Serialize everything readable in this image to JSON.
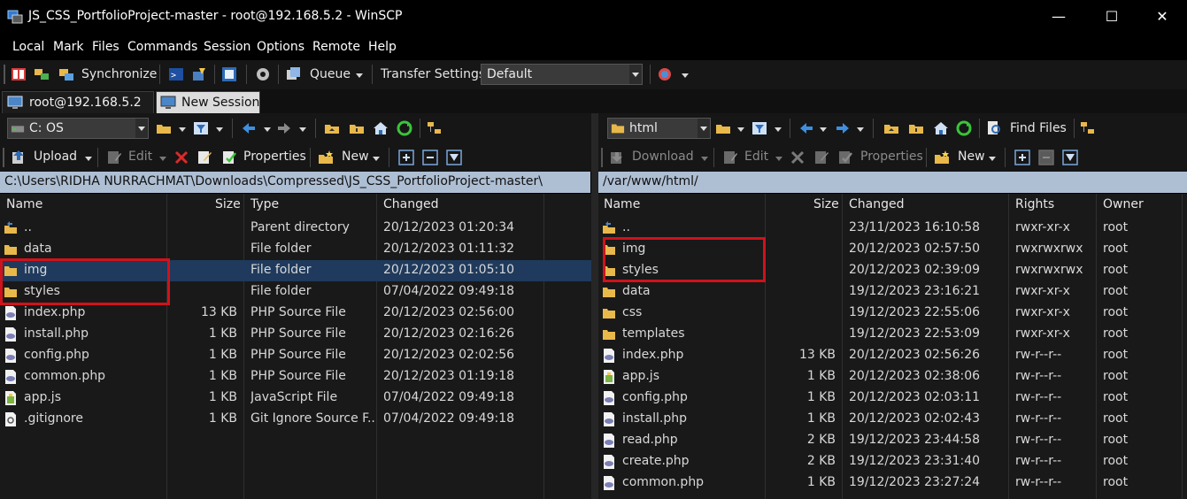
{
  "window": {
    "title": "JS_CSS_PortfolioProject-master - root@192.168.5.2 - WinSCP",
    "minimize": "—",
    "maximize": "☐",
    "close": "✕"
  },
  "menu": [
    "Local",
    "Mark",
    "Files",
    "Commands",
    "Session",
    "Options",
    "Remote",
    "Help"
  ],
  "toolbar": {
    "synchronize": "Synchronize",
    "queue": "Queue",
    "transfer_settings": "Transfer Settings",
    "transfer_preset": "Default"
  },
  "tabs": {
    "session": "root@192.168.5.2",
    "new_session": "New Session"
  },
  "local": {
    "drive": "C: OS",
    "upload": "Upload",
    "edit": "Edit",
    "properties": "Properties",
    "new": "New",
    "path": "C:\\Users\\RIDHA NURRACHMAT\\Downloads\\Compressed\\JS_CSS_PortfolioProject-master\\",
    "columns": [
      "Name",
      "Size",
      "Type",
      "Changed"
    ],
    "rows": [
      {
        "icon": "parent-dir",
        "name": "..",
        "size": "",
        "type": "Parent directory",
        "changed": "20/12/2023  01:20:34"
      },
      {
        "icon": "folder",
        "name": "data",
        "size": "",
        "type": "File folder",
        "changed": "20/12/2023  01:11:32"
      },
      {
        "icon": "folder",
        "name": "img",
        "size": "",
        "type": "File folder",
        "changed": "20/12/2023  01:05:10"
      },
      {
        "icon": "folder",
        "name": "styles",
        "size": "",
        "type": "File folder",
        "changed": "07/04/2022  09:49:18"
      },
      {
        "icon": "php",
        "name": "index.php",
        "size": "13 KB",
        "type": "PHP Source File",
        "changed": "20/12/2023  02:56:00"
      },
      {
        "icon": "php",
        "name": "install.php",
        "size": "1 KB",
        "type": "PHP Source File",
        "changed": "20/12/2023  02:16:26"
      },
      {
        "icon": "php",
        "name": "config.php",
        "size": "1 KB",
        "type": "PHP Source File",
        "changed": "20/12/2023  02:02:56"
      },
      {
        "icon": "php",
        "name": "common.php",
        "size": "1 KB",
        "type": "PHP Source File",
        "changed": "20/12/2023  01:19:18"
      },
      {
        "icon": "js",
        "name": "app.js",
        "size": "1 KB",
        "type": "JavaScript File",
        "changed": "07/04/2022  09:49:18"
      },
      {
        "icon": "gitignore",
        "name": ".gitignore",
        "size": "1 KB",
        "type": "Git Ignore Source F...",
        "changed": "07/04/2022  09:49:18"
      }
    ]
  },
  "remote": {
    "dir": "html",
    "download": "Download",
    "edit": "Edit",
    "properties": "Properties",
    "new": "New",
    "find_files": "Find Files",
    "path": "/var/www/html/",
    "columns": [
      "Name",
      "Size",
      "Changed",
      "Rights",
      "Owner"
    ],
    "rows": [
      {
        "icon": "parent-dir",
        "name": "..",
        "size": "",
        "changed": "23/11/2023 16:10:58",
        "rights": "rwxr-xr-x",
        "owner": "root"
      },
      {
        "icon": "folder",
        "name": "img",
        "size": "",
        "changed": "20/12/2023 02:57:50",
        "rights": "rwxrwxrwx",
        "owner": "root"
      },
      {
        "icon": "folder",
        "name": "styles",
        "size": "",
        "changed": "20/12/2023 02:39:09",
        "rights": "rwxrwxrwx",
        "owner": "root"
      },
      {
        "icon": "folder",
        "name": "data",
        "size": "",
        "changed": "19/12/2023 23:16:21",
        "rights": "rwxr-xr-x",
        "owner": "root"
      },
      {
        "icon": "folder",
        "name": "css",
        "size": "",
        "changed": "19/12/2023 22:55:06",
        "rights": "rwxr-xr-x",
        "owner": "root"
      },
      {
        "icon": "folder",
        "name": "templates",
        "size": "",
        "changed": "19/12/2023 22:53:09",
        "rights": "rwxr-xr-x",
        "owner": "root"
      },
      {
        "icon": "php",
        "name": "index.php",
        "size": "13 KB",
        "changed": "20/12/2023 02:56:26",
        "rights": "rw-r--r--",
        "owner": "root"
      },
      {
        "icon": "js",
        "name": "app.js",
        "size": "1 KB",
        "changed": "20/12/2023 02:38:06",
        "rights": "rw-r--r--",
        "owner": "root"
      },
      {
        "icon": "php",
        "name": "config.php",
        "size": "1 KB",
        "changed": "20/12/2023 02:03:11",
        "rights": "rw-r--r--",
        "owner": "root"
      },
      {
        "icon": "php",
        "name": "install.php",
        "size": "1 KB",
        "changed": "20/12/2023 02:02:43",
        "rights": "rw-r--r--",
        "owner": "root"
      },
      {
        "icon": "php",
        "name": "read.php",
        "size": "2 KB",
        "changed": "19/12/2023 23:44:58",
        "rights": "rw-r--r--",
        "owner": "root"
      },
      {
        "icon": "php",
        "name": "create.php",
        "size": "2 KB",
        "changed": "19/12/2023 23:31:40",
        "rights": "rw-r--r--",
        "owner": "root"
      },
      {
        "icon": "php",
        "name": "common.php",
        "size": "1 KB",
        "changed": "19/12/2023 23:27:24",
        "rights": "rw-r--r--",
        "owner": "root"
      }
    ]
  },
  "colors": {
    "highlight_box": "#d0121b",
    "path_bar": "#aebfd4",
    "folder": "#e8b84a",
    "selection": "#1f3a5c"
  }
}
